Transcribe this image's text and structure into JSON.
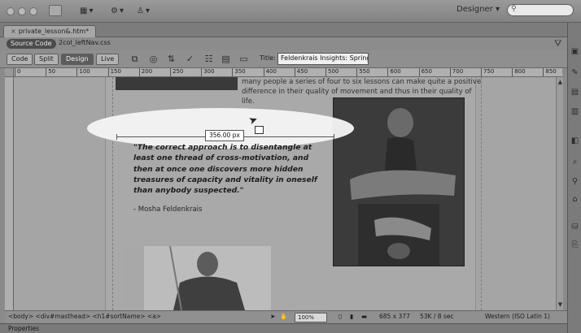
{
  "window": {
    "workspace": "Designer",
    "workspace_chevron": "▾"
  },
  "toolbar": {
    "layout_icon": "grid-icon",
    "extend_icon": "gear-icon",
    "site_icon": "user-icon"
  },
  "document": {
    "tab_title": "private_lesson&.htm*",
    "source_code": "Source Code",
    "related_file": "2col_leftNav.css",
    "views": [
      "Code",
      "Split",
      "Design",
      "Live"
    ],
    "active_view": "Design",
    "title_label": "Title:",
    "title_value": "Feldenkrais Insights: Spring C"
  },
  "ruler": {
    "labels": [
      "0",
      "50",
      "100",
      "150",
      "200",
      "250",
      "300",
      "350",
      "400",
      "450",
      "500",
      "550",
      "600",
      "650",
      "700",
      "750",
      "800",
      "850"
    ]
  },
  "content": {
    "intro": "many people a series of four to six lessons can make quite a positive difference in their quality of movement and thus in their quality of life.",
    "measure": "356.00 px",
    "quote": "\"The correct approach is to disentangle at least one thread of cross-motivation, and then at once one discovers more hidden treasures of capacity and vitality in oneself than anybody suspected.\"",
    "author": "- Mosha Feldenkrais"
  },
  "status": {
    "tag_selector": "<body> <div#masthead> <h1#sortName> <a>",
    "zoom": "100%",
    "dimensions": "685 x 377",
    "download": "53K / 8 sec",
    "encoding": "Western (ISO Latin 1)"
  },
  "panels": {
    "properties": "Properties"
  }
}
